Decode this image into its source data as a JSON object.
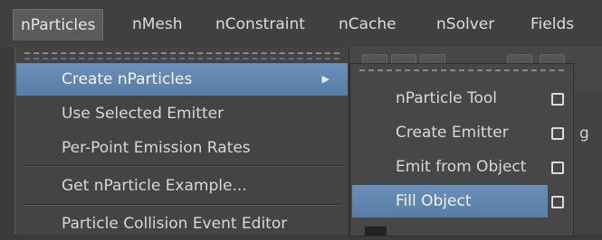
{
  "menubar": {
    "items": [
      {
        "label": "nParticles",
        "active": true
      },
      {
        "label": "nMesh"
      },
      {
        "label": "nConstraint"
      },
      {
        "label": "nCache"
      },
      {
        "label": "nSolver"
      },
      {
        "label": "Fields"
      }
    ]
  },
  "main_menu": {
    "items": [
      {
        "label": "Create nParticles",
        "highlighted": true,
        "has_submenu": true
      },
      {
        "label": "Use Selected Emitter"
      },
      {
        "label": "Per-Point Emission Rates"
      },
      {
        "label": "Get nParticle Example..."
      },
      {
        "label": "Particle Collision Event Editor"
      }
    ],
    "submenu_arrow": "▶"
  },
  "submenu": {
    "items": [
      {
        "label": "nParticle Tool"
      },
      {
        "label": "Create Emitter"
      },
      {
        "label": "Emit from Object"
      },
      {
        "label": "Fill Object",
        "highlighted": true
      }
    ]
  },
  "background": {
    "fragment": "g"
  },
  "colors": {
    "highlight": "#6b8fb8",
    "menu_bg": "#444444",
    "menubar_bg": "#404040"
  }
}
